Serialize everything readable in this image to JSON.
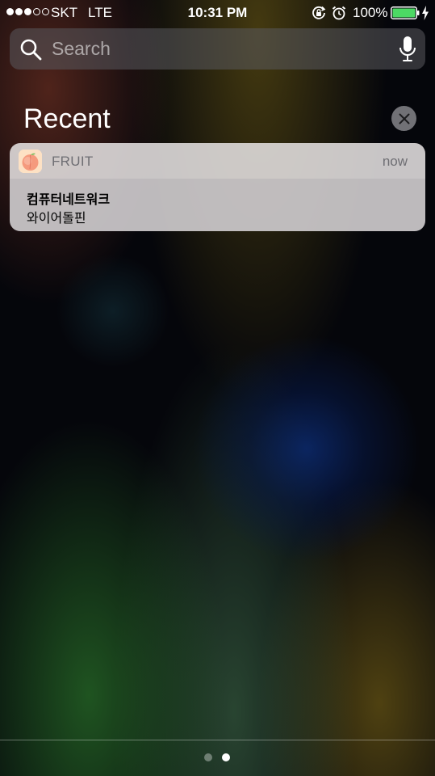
{
  "status_bar": {
    "signal": {
      "filled": 3,
      "total": 5
    },
    "carrier": "SKT",
    "network": "LTE",
    "time": "10:31 PM",
    "battery_percent": "100%",
    "battery_level": 1.0,
    "battery_color": "#4cd964",
    "icons": [
      "orientation-lock-icon",
      "alarm-icon",
      "battery-icon",
      "charging-icon"
    ]
  },
  "search": {
    "placeholder": "Search",
    "value": "",
    "icons": [
      "search-icon",
      "mic-icon"
    ]
  },
  "recent": {
    "title": "Recent",
    "clear_icon": "close-icon"
  },
  "notification": {
    "app_name": "FRUIT",
    "app_icon": "peach-app-icon",
    "time": "now",
    "title": "컴퓨터네트워크",
    "message": "와이어돌핀"
  },
  "pager": {
    "pages": 2,
    "current": 2
  }
}
